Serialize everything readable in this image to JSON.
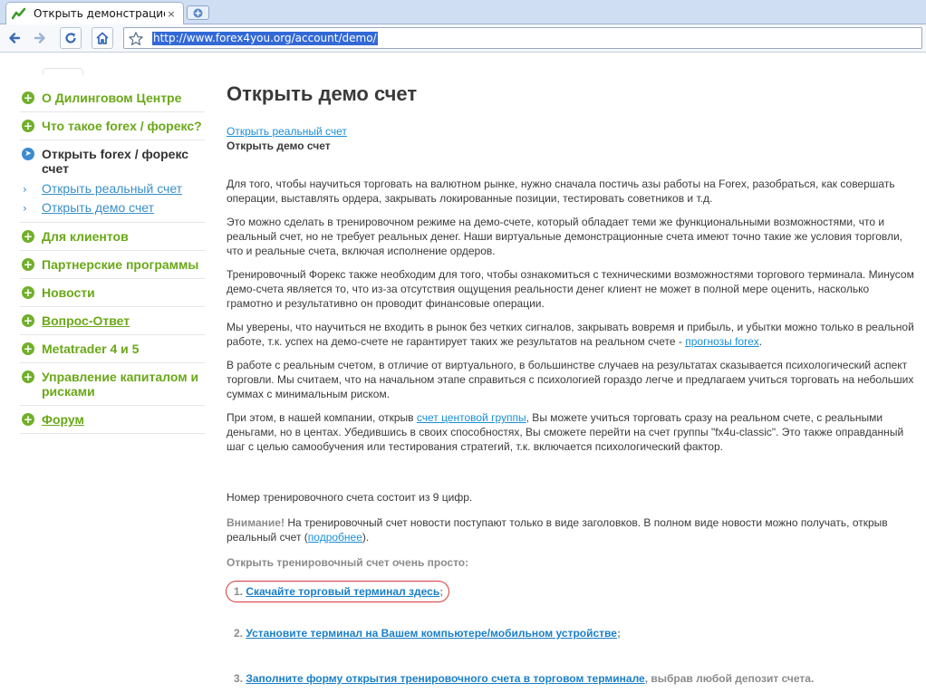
{
  "browser": {
    "tab_title": "Открыть демонстрацион...",
    "tab_close": "×",
    "url": "http://www.forex4you.org/account/demo/"
  },
  "sidebar": {
    "items_before": [
      {
        "label": "О Дилинговом Центре"
      },
      {
        "label": "Что такое forex / форекс?"
      }
    ],
    "current": {
      "label": "Открыть forex / форекс счет",
      "sub": [
        {
          "arrow": "›",
          "label": "Открыть реальный счет"
        },
        {
          "arrow": "›",
          "label": "Открыть демо счет"
        }
      ]
    },
    "items_after": [
      {
        "label": "Для клиентов"
      },
      {
        "label": "Партнерские программы"
      },
      {
        "label": "Новости"
      },
      {
        "label": "Вопрос-Ответ"
      },
      {
        "label": "Metatrader 4 и 5"
      },
      {
        "label": "Управление капиталом и рисками"
      },
      {
        "label": "Форум"
      }
    ]
  },
  "content": {
    "title": "Открыть демо счет",
    "link_real": "Открыть реальный счет",
    "current_demo": "Открыть демо счет",
    "p1": "Для того, чтобы научиться торговать на валютном рынке,  нужно сначала постичь азы работы на Forex, разобраться, как совершать операции, выставлять ордера, закрывать локированные позиции, тестировать советников и т.д.",
    "p2": "Это можно сделать в тренировочном режиме на демо-счете, который обладает теми же функциональными возможностями, что и реальный счет, но не требует реальных денег. Наши виртуальные демонстрационные счета имеют точно такие же условия торговли, что и реальные счета, включая исполнение ордеров.",
    "p3": "Тренировочный Форекс также необходим для того, чтобы ознакомиться с техническими возможностями торгового терминала. Минусом демо-счета является то, что из-за отсутствия ощущения реальности денег клиент не может в полной мере оценить, насколько грамотно и результативно он проводит финансовые операции.",
    "p4_text": "Мы уверены, что научиться не входить в рынок без четких сигналов, закрывать вовремя и прибыль, и убытки можно только в реальной работе, т.к. успех на демо-счете не гарантирует таких же результатов на реальном счете - ",
    "p4_link": "прогнозы forex",
    "p4_end": ".",
    "p5": "В работе с реальным счетом, в отличие от виртуального, в большинстве случаев на результатах сказывается психологический аспект торговли. Мы считаем, что на начальном этапе справиться с психологией гораздо легче и предлагаем учиться торговать на небольших суммах с минимальным риском.",
    "p6_a": "При этом, в нашей компании, открыв ",
    "p6_link": "счет центовой группы",
    "p6_b": ", Вы можете учиться торговать сразу на реальном счете, с реальными деньгами, но в центах. Убедившись в своих способностях, Вы сможете перейти на счет группы \"fx4u-classic\". Это также оправданный шаг с целью самообучения или тестирования стратегий, т.к. включается психологический фактор.",
    "p7": "Номер тренировочного счета состоит из 9 цифр.",
    "warn_label": "Внимание!",
    "warn_text": " На тренировочный счет новости поступают только в виде заголовков. В полном виде новости можно получать, открыв реальный счет (",
    "warn_link": "подробнее",
    "warn_end": ").",
    "easy": "Открыть тренировочный счет очень просто:",
    "steps": [
      {
        "num": "1.",
        "link": "Скачайте торговый терминал здесь",
        "tail": ";"
      },
      {
        "num": "2.",
        "link": "Установите терминал на Вашем компьютере/мобильном устройстве",
        "tail": ";"
      },
      {
        "num": "3.",
        "link": "Заполните форму открытия тренировочного счета в торговом терминале",
        "tail": ", выбрав любой депозит счета."
      }
    ]
  }
}
